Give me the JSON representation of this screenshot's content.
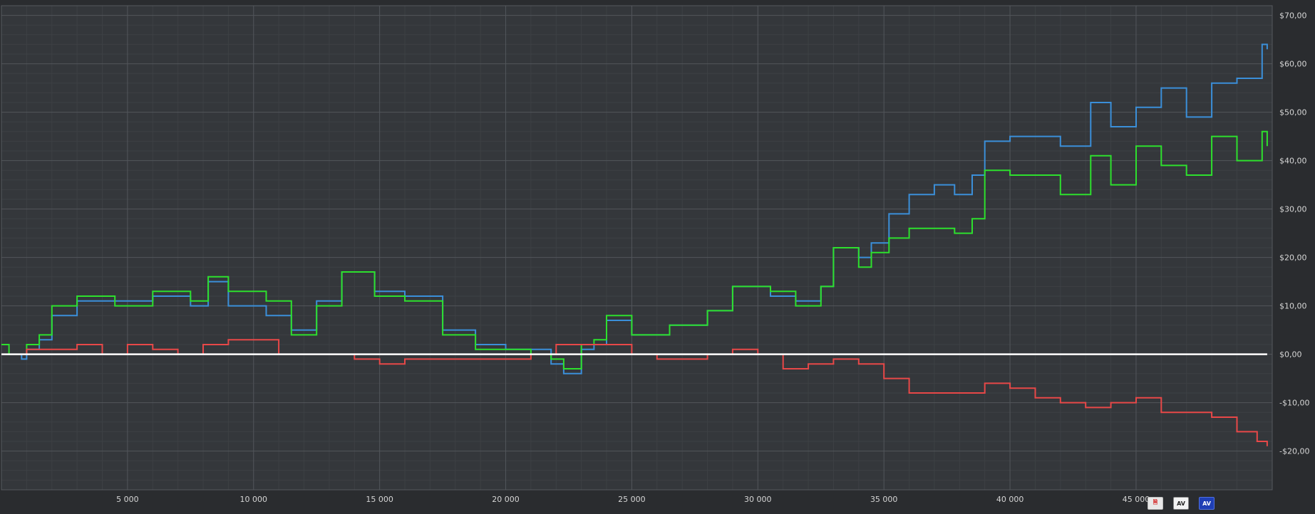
{
  "chart_data": {
    "type": "line",
    "title": "",
    "xlabel": "",
    "ylabel": "",
    "xlim": [
      0,
      50400
    ],
    "ylim": [
      -28,
      72
    ],
    "x_ticks": [
      5000,
      10000,
      15000,
      20000,
      25000,
      30000,
      35000,
      40000,
      45000
    ],
    "x_tick_labels": [
      "5 000",
      "10 000",
      "15 000",
      "20 000",
      "25 000",
      "30 000",
      "35 000",
      "40 000",
      "45 000"
    ],
    "y_ticks": [
      70,
      60,
      50,
      40,
      30,
      20,
      10,
      0,
      -10,
      -20
    ],
    "y_tick_labels": [
      "$70,00",
      "$60,00",
      "$50,00",
      "$40,00",
      "$30,00",
      "$20,00",
      "$10,00",
      "$0,00",
      "-$10,00",
      "-$20,00"
    ],
    "grid": true,
    "zero_line": true,
    "series": [
      {
        "color": "#3b8fd9",
        "x": [
          0,
          300,
          800,
          1000,
          1500,
          2000,
          3000,
          4500,
          6000,
          7500,
          8200,
          9000,
          10500,
          11500,
          12500,
          13500,
          14800,
          16000,
          17500,
          18800,
          20000,
          21000,
          21800,
          22300,
          23000,
          23500,
          24000,
          25000,
          26500,
          28000,
          29000,
          30500,
          31500,
          32500,
          33000,
          34000,
          34500,
          35200,
          36000,
          37000,
          37800,
          38500,
          39000,
          40000,
          42000,
          43200,
          44000,
          45000,
          46000,
          47000,
          48000,
          49000,
          50000,
          50200
        ],
        "y": [
          0,
          0,
          -1,
          1,
          3,
          8,
          11,
          11,
          12,
          10,
          15,
          10,
          8,
          5,
          11,
          17,
          13,
          12,
          5,
          2,
          1,
          1,
          -2,
          -4,
          1,
          2,
          7,
          4,
          6,
          9,
          14,
          12,
          11,
          14,
          22,
          20,
          23,
          29,
          33,
          35,
          33,
          37,
          44,
          45,
          43,
          52,
          47,
          51,
          55,
          49,
          56,
          57,
          64,
          63
        ]
      },
      {
        "color": "#2de02d",
        "x": [
          0,
          300,
          800,
          1000,
          1500,
          2000,
          3000,
          4500,
          6000,
          7500,
          8200,
          9000,
          10500,
          11500,
          12500,
          13500,
          14800,
          16000,
          17500,
          18800,
          20000,
          21000,
          21800,
          22300,
          23000,
          23500,
          24000,
          25000,
          26500,
          28000,
          29000,
          30500,
          31500,
          32500,
          33000,
          34000,
          34500,
          35200,
          36000,
          37000,
          37800,
          38500,
          39000,
          40000,
          42000,
          43200,
          44000,
          45000,
          46000,
          47000,
          48000,
          49000,
          50000,
          50200
        ],
        "y": [
          2,
          0,
          0,
          2,
          4,
          10,
          12,
          10,
          13,
          11,
          16,
          13,
          11,
          4,
          10,
          17,
          12,
          11,
          4,
          1,
          1,
          0,
          -1,
          -3,
          2,
          3,
          8,
          4,
          6,
          9,
          14,
          13,
          10,
          14,
          22,
          18,
          21,
          24,
          26,
          26,
          25,
          28,
          38,
          37,
          33,
          41,
          35,
          43,
          39,
          37,
          45,
          40,
          46,
          43
        ]
      },
      {
        "color": "#e84848",
        "x": [
          0,
          500,
          1000,
          2000,
          3000,
          4000,
          5000,
          6000,
          7000,
          8000,
          9000,
          10000,
          11000,
          12000,
          13000,
          14000,
          15000,
          16000,
          17000,
          18000,
          19000,
          20000,
          21000,
          22000,
          23000,
          24000,
          25000,
          26000,
          27000,
          28000,
          29000,
          30000,
          31000,
          32000,
          33000,
          34000,
          35000,
          36000,
          37000,
          38000,
          39000,
          40000,
          41000,
          42000,
          43000,
          44000,
          45000,
          46000,
          47000,
          48000,
          49000,
          49800,
          50200
        ],
        "y": [
          0,
          0,
          1,
          1,
          2,
          0,
          2,
          1,
          0,
          2,
          3,
          3,
          0,
          0,
          0,
          -1,
          -2,
          -1,
          -1,
          -1,
          -1,
          -1,
          0,
          2,
          2,
          2,
          0,
          -1,
          -1,
          0,
          1,
          0,
          -3,
          -2,
          -1,
          -2,
          -5,
          -8,
          -8,
          -8,
          -6,
          -7,
          -9,
          -10,
          -11,
          -10,
          -9,
          -12,
          -12,
          -13,
          -16,
          -18,
          -19
        ]
      },
      {
        "color": "#ffffff",
        "x": [
          0,
          50200
        ],
        "y": [
          0,
          0
        ]
      }
    ]
  },
  "toolbar": {
    "buttons": [
      {
        "icon": "red-export-icon",
        "label": ""
      },
      {
        "icon": "av-white-icon",
        "label": "AV"
      },
      {
        "icon": "av-blue-icon",
        "label": "AV"
      }
    ]
  }
}
